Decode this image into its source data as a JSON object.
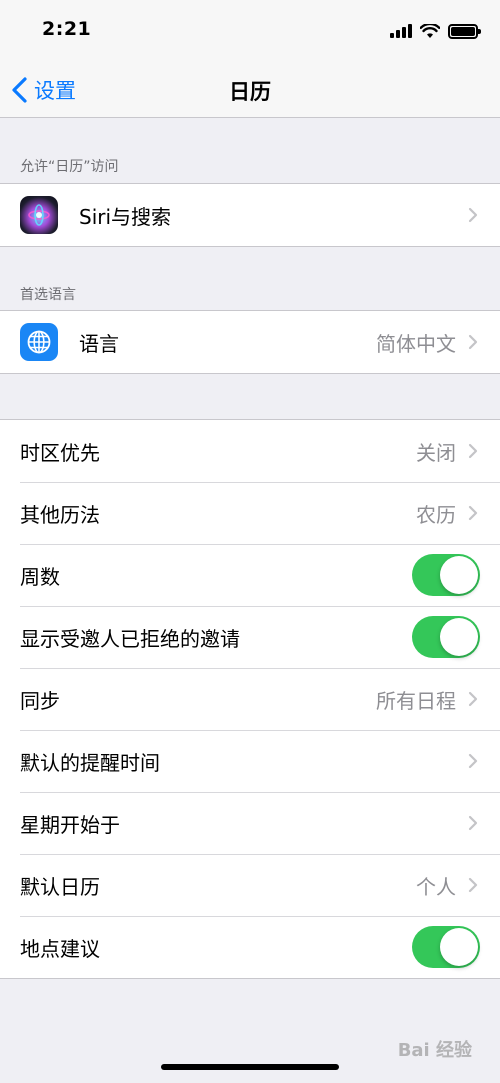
{
  "status_bar": {
    "time": "2:21"
  },
  "nav": {
    "back_label": "设置",
    "title": "日历"
  },
  "sections": {
    "access_header": "允许“日历”访问",
    "language_header": "首选语言"
  },
  "access_rows": [
    {
      "label": "Siri与搜索",
      "icon": "siri-icon"
    }
  ],
  "language_rows": [
    {
      "label": "语言",
      "value": "简体中文",
      "icon": "globe-icon"
    }
  ],
  "settings_rows": [
    {
      "label": "时区优先",
      "value": "关闭"
    },
    {
      "label": "其他历法",
      "value": "农历"
    },
    {
      "label": "周数",
      "toggle": true
    },
    {
      "label": "显示受邀人已拒绝的邀请",
      "toggle": true
    },
    {
      "label": "同步",
      "value": "所有日程"
    },
    {
      "label": "默认的提醒时间",
      "value": ""
    },
    {
      "label": "星期开始于",
      "value": ""
    },
    {
      "label": "默认日历",
      "value": "个人"
    },
    {
      "label": "地点建议",
      "toggle": true
    }
  ],
  "colors": {
    "accent": "#0a7aff",
    "toggle_on": "#34c759",
    "background": "#efeff4"
  },
  "watermark": "Bai 经验"
}
